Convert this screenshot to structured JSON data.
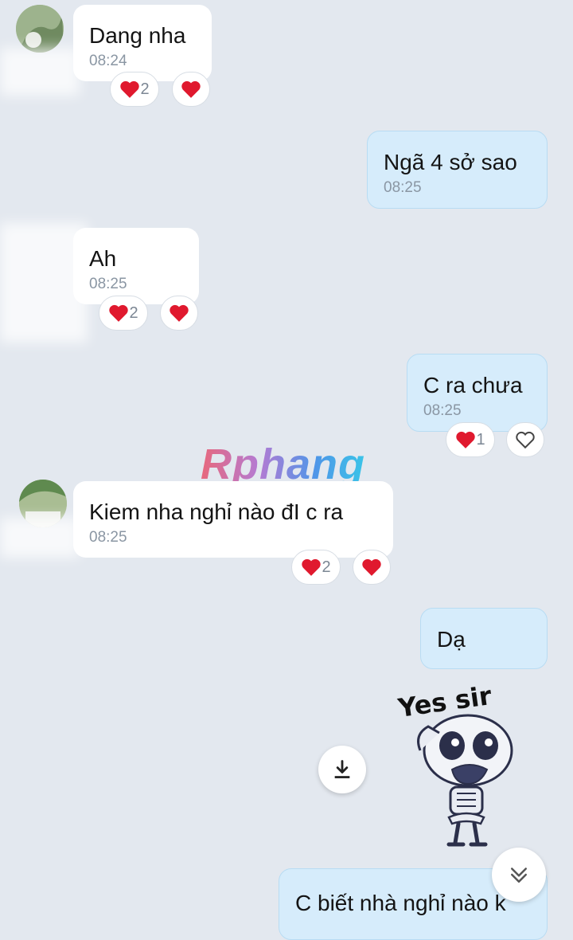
{
  "messages": [
    {
      "text": "Dang nha",
      "time": "08:24",
      "reaction_count": "2"
    },
    {
      "text": "Ngã 4 sở sao",
      "time": "08:25"
    },
    {
      "text": "Ah",
      "time": "08:25",
      "reaction_count": "2"
    },
    {
      "text": "C ra chưa",
      "time": "08:25",
      "reaction_count": "1"
    },
    {
      "text": "Kiem nha nghỉ nào đI c ra",
      "time": "08:25",
      "reaction_count": "2"
    },
    {
      "text": "Dạ"
    },
    {
      "text": "C biết nhà nghỉ nào k"
    }
  ],
  "watermark": "Rphang",
  "sticker": {
    "caption": "Yes sir"
  },
  "colors": {
    "background": "#e3e8ef",
    "incoming": "#ffffff",
    "outgoing": "#d6ecfb",
    "heart": "#e0192e"
  },
  "icons": {
    "download": "download-icon",
    "scroll_down": "chevron-double-down-icon",
    "react": "heart-outline-icon"
  }
}
